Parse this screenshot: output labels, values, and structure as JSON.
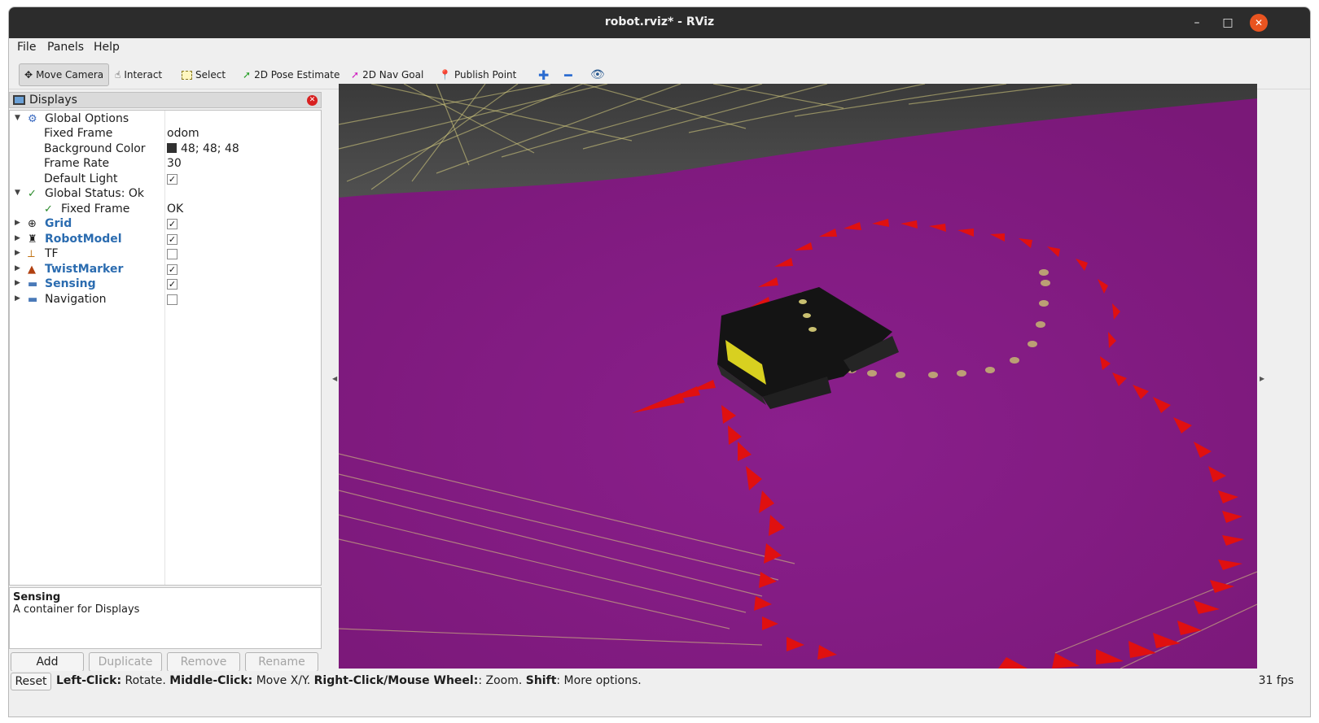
{
  "window": {
    "title": "robot.rviz* - RViz",
    "controls": {
      "minimize": "–",
      "maximize": "□",
      "close": "✕"
    }
  },
  "menu": {
    "items": [
      "File",
      "Panels",
      "Help"
    ]
  },
  "toolbar": {
    "move_camera": "Move Camera",
    "interact": "Interact",
    "select": "Select",
    "pose_estimate": "2D Pose Estimate",
    "nav_goal": "2D Nav Goal",
    "publish_point": "Publish Point"
  },
  "displays": {
    "title": "Displays",
    "global_options": {
      "label": "Global Options",
      "fixed_frame": {
        "label": "Fixed Frame",
        "value": "odom"
      },
      "background_color": {
        "label": "Background Color",
        "value": "48; 48; 48",
        "color": "#303030"
      },
      "frame_rate": {
        "label": "Frame Rate",
        "value": "30"
      },
      "default_light": {
        "label": "Default Light",
        "checked": true
      }
    },
    "global_status": {
      "label": "Global Status: Ok",
      "fixed_frame": {
        "label": "Fixed Frame",
        "value": "OK"
      }
    },
    "items": [
      {
        "label": "Grid",
        "checked": true,
        "bold": true,
        "icon": "grid-icon"
      },
      {
        "label": "RobotModel",
        "checked": true,
        "bold": true,
        "icon": "robot-icon"
      },
      {
        "label": "TF",
        "checked": false,
        "bold": false,
        "icon": "axes-icon"
      },
      {
        "label": "TwistMarker",
        "checked": true,
        "bold": true,
        "icon": "marker-icon"
      },
      {
        "label": "Sensing",
        "checked": true,
        "bold": true,
        "icon": "folder-icon"
      },
      {
        "label": "Navigation",
        "checked": false,
        "bold": false,
        "icon": "folder-icon"
      }
    ]
  },
  "description": {
    "title": "Sensing",
    "text": "A container for Displays"
  },
  "panel_buttons": {
    "add": "Add",
    "duplicate": "Duplicate",
    "remove": "Remove",
    "rename": "Rename"
  },
  "status": {
    "reset": "Reset",
    "hint_parts": [
      {
        "bold": "Left-Click:",
        "text": " Rotate. "
      },
      {
        "bold": "Middle-Click:",
        "text": " Move X/Y. "
      },
      {
        "bold": "Right-Click/Mouse Wheel:",
        "text": ": Zoom. "
      },
      {
        "bold": "Shift",
        "text": ": More options."
      }
    ],
    "fps": "31 fps"
  },
  "colors": {
    "ground": "#8a1e8a",
    "arrow": "#e01010",
    "laser": "#d8d080",
    "titlebar": "#2c2c2c",
    "accent_close": "#e95420"
  }
}
